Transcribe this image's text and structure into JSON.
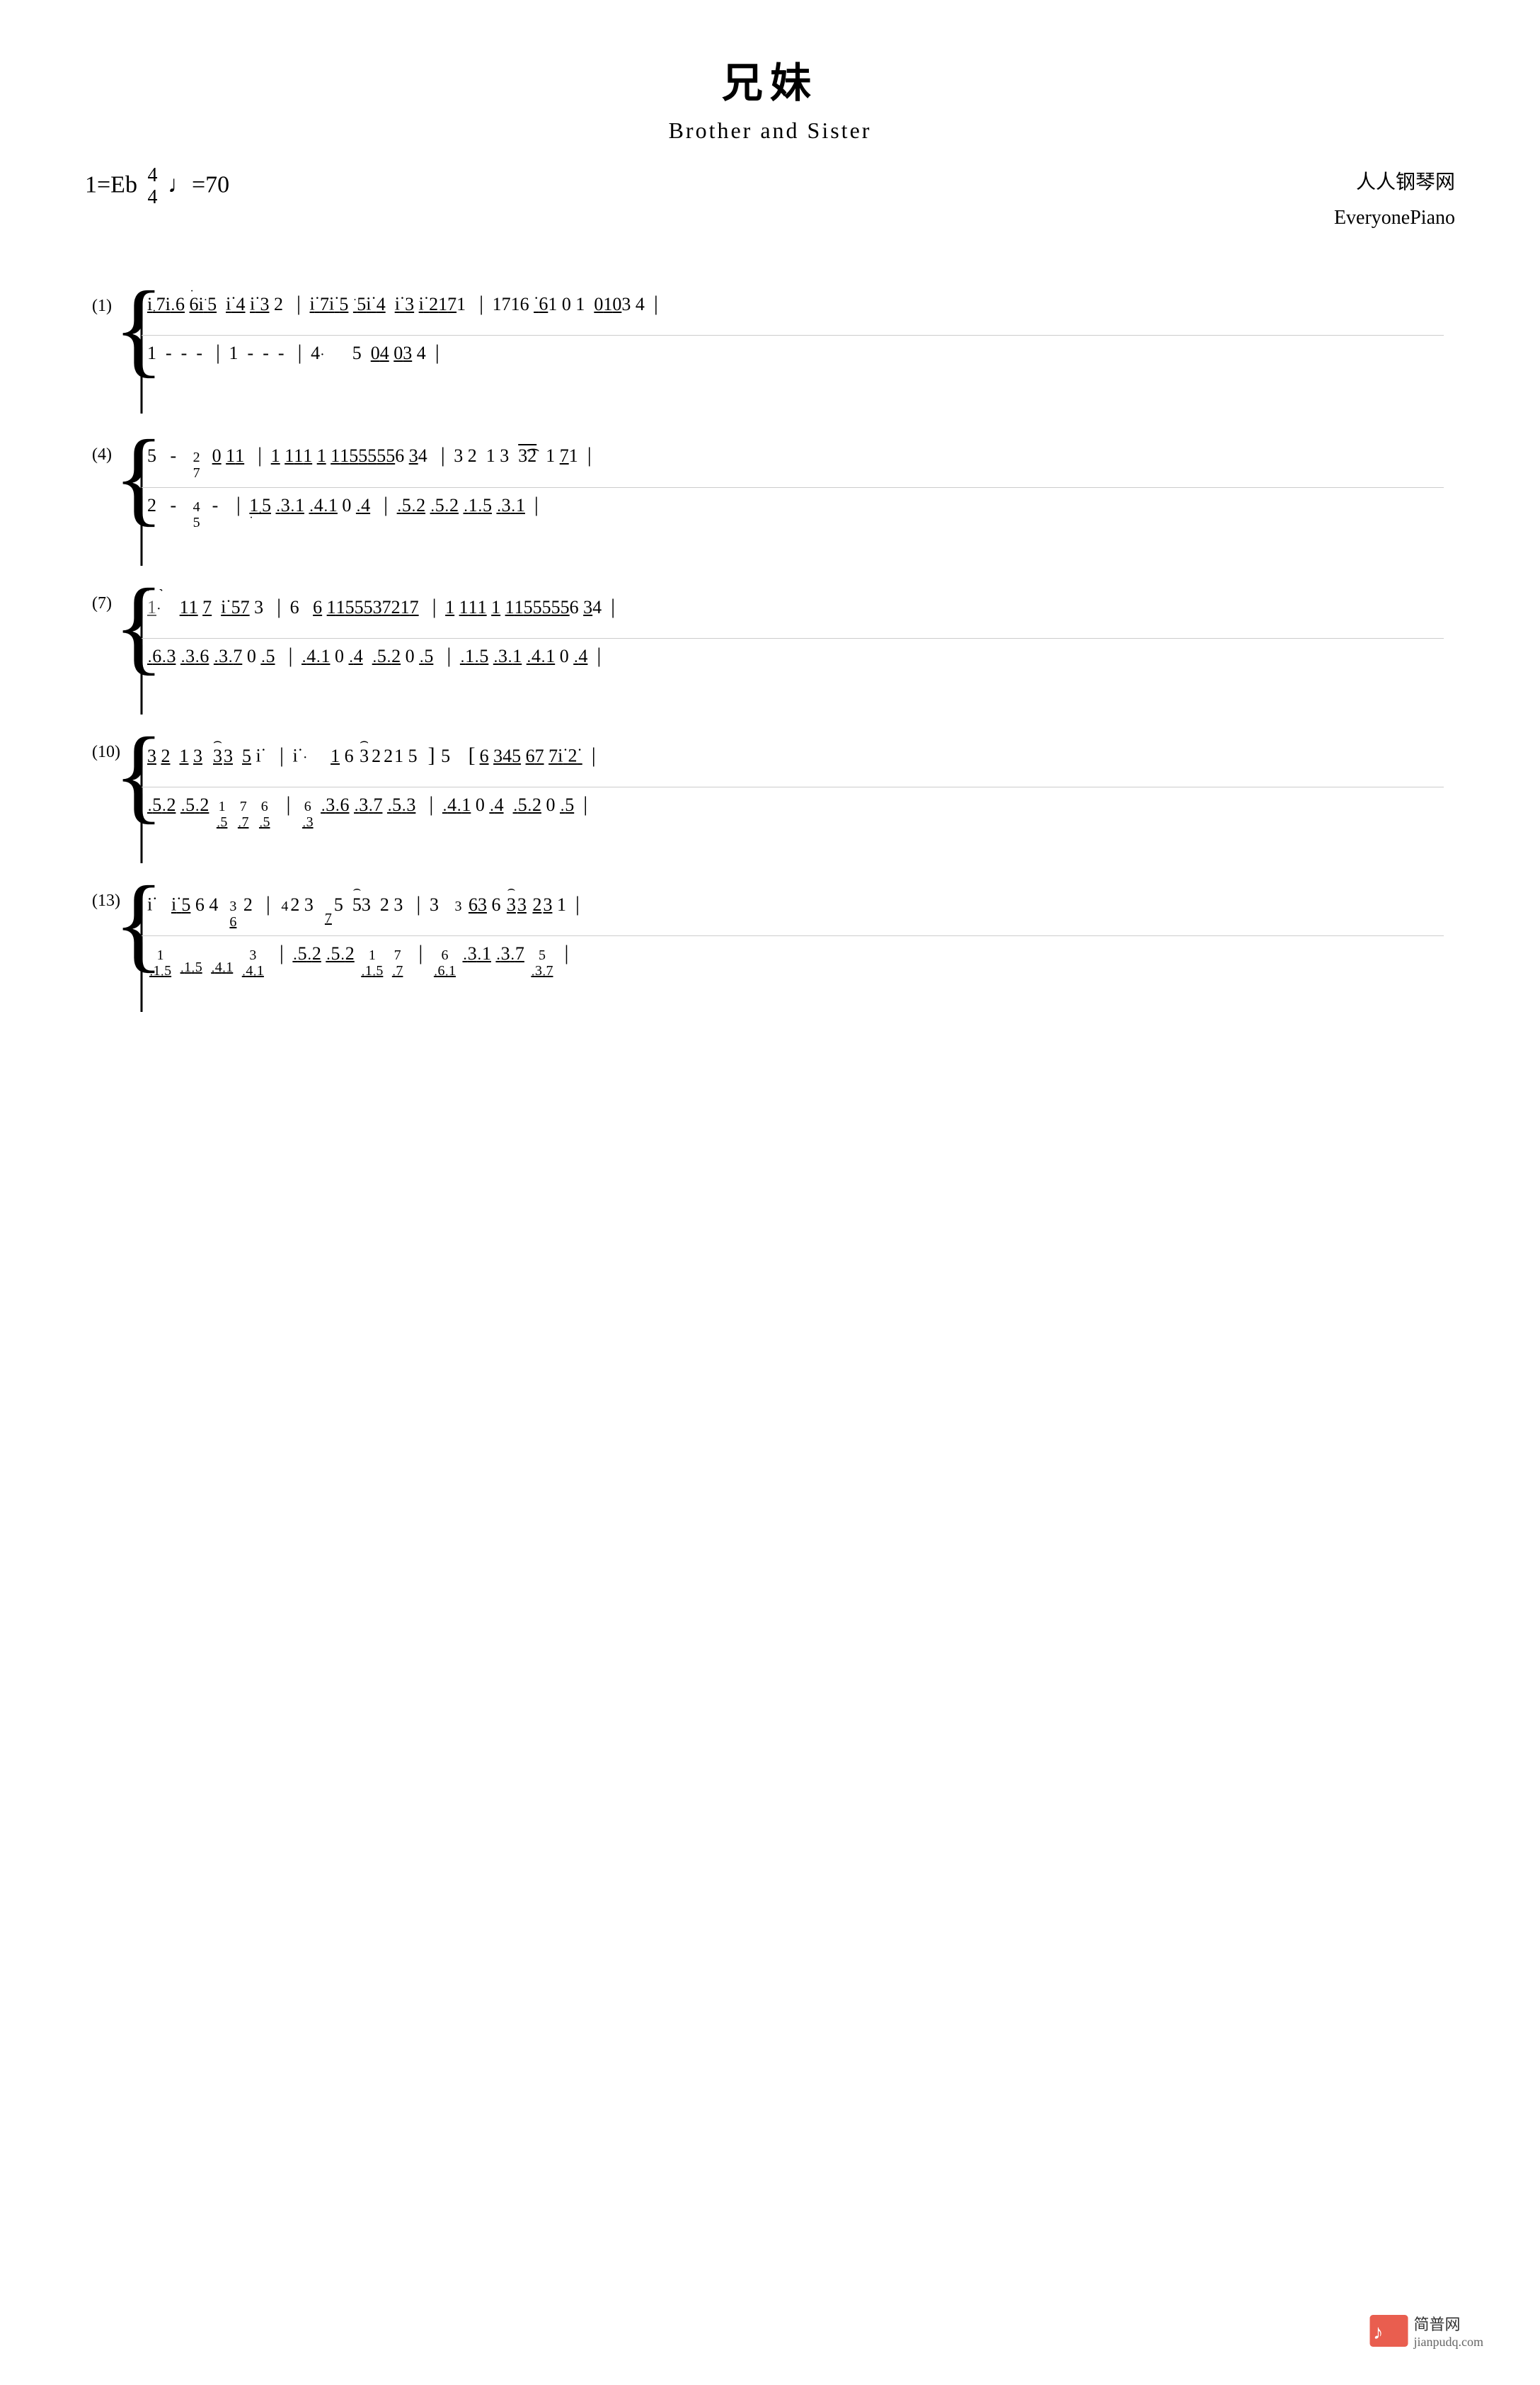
{
  "page": {
    "title": "兄妹",
    "subtitle": "Brother and Sister",
    "key_signature": "1=Eb",
    "time_signature_num": "4",
    "time_signature_den": "4",
    "tempo": "♩=70",
    "source_cn": "人人钢琴网",
    "source_en": "EveryonePiano",
    "watermark_url": "jianpudq.com",
    "watermark_cn": "简普网",
    "systems": [
      {
        "label": "(1)",
        "treble": "i̱7i̱6 6̱i̱5  i̱4 i̱3 2 | i̱7i̱5 5̱i̱4  i̱3 i̱2171 | 1716 6̱1 0 1  0103 4",
        "bass": "1  -  -  - | 1  -  -  - | 4·  5  0̱4̱ 0̱3̱ 4"
      },
      {
        "label": "(4)",
        "treble": "5  -  2/7  0̱ 1̱1 | 1̱ 1̱1̱1 1̱ 1̱1̱5̱5̱5̱5̱6 3̱4̱ | 3 2  1 3  3̃2  1 71",
        "bass": "2  -  4/5  - | 1̤/5̤  3̤1̤  4̤1̤  0 4̤ | 5̤2̤  5̤2̤  1̤5̤  3̤1̤"
      },
      {
        "label": "(7)",
        "treble": "1·  1̱1̱ 7  i̱5̱7̱ 3 | 6  6̱ 1̱1̱5̱5̱5̱3̱7̱2̱1̱7̱ | 1̱ 1̱1̱1 1̱ 1̱1̱5̱5̱5̱5̱6 3̱4̱",
        "bass": "6/3̤  3̤6̤  3̤7̤  0 5̤ | 4̤1̤  0 4̤  5̤2̤  0 5̤ | 1̤5̤  3̤1̤  4̤1̤  0 4̤"
      },
      {
        "label": "(10)",
        "treble": "3 2  1 3  3̃3  5 i | i·  1 6 3̃2̃ 2̃1 5 | 5  6 3̱4̱5̱ 6̱7̱ 7̱i̱2̱",
        "bass": "5̤2̤  5̤2̤  1/5  7/7  6/5 | 6/3̤  3̤6̤  3̤7̤  5̤ 3̤ | 4̤1̤  0 4̤  5̤2̤  0 5̤"
      },
      {
        "label": "(13)",
        "treble": "i  i̱5̱ 6 4  3/6̱ 2 | 2 3  4/7̱ 5  5̃3  2 3 | 3  6̱3̱ 6 3̱3̃ 2̃3 1",
        "bass": "1/1̤5̤  1̤5̤  4̤1̤  4̤1̤ | 5̤2̤  5̤2̤  1/1̤5̤  7̤/7̤  6/6̤1̤  3̤1̤  3̤7̤  3̤7̤"
      }
    ]
  }
}
